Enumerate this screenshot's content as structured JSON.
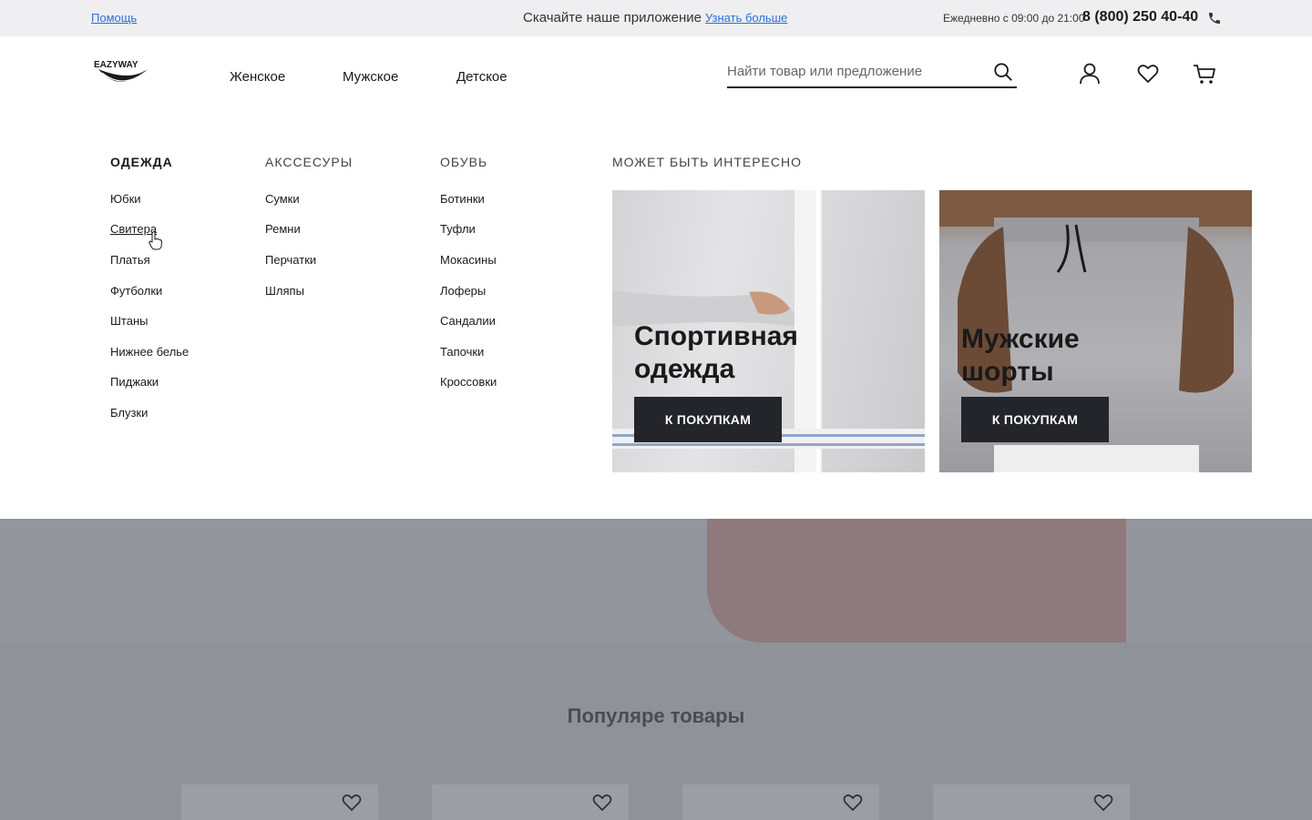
{
  "topbar": {
    "help": "Помощь",
    "promo": "Скачайте наше приложение",
    "promo_link": "Узнать больше",
    "hours": "Ежедневно с 09:00 до 21:00",
    "phone": "8 (800) 250 40-40"
  },
  "header": {
    "logo_text": "EAZYWAY",
    "nav": [
      "Женское",
      "Мужское",
      "Детское"
    ],
    "search_placeholder": "Найти товар или предложение"
  },
  "menu": {
    "columns": [
      {
        "title": "ОДЕЖДА",
        "items": [
          "Юбки",
          "Свитера",
          "Платья",
          "Футболки",
          "Штаны",
          "Нижнее белье",
          "Пиджаки",
          "Блузки"
        ]
      },
      {
        "title": "АКССЕСУРЫ",
        "items": [
          "Сумки",
          "Ремни",
          "Перчатки",
          "Шляпы"
        ]
      },
      {
        "title": "ОБУВЬ",
        "items": [
          "Ботинки",
          "Туфли",
          "Мокасины",
          "Лоферы",
          "Сандалии",
          "Тапочки",
          "Кроссовки"
        ]
      }
    ],
    "featured_title": "МОЖЕТ БЫТЬ ИНТЕРЕСНО",
    "cards": [
      {
        "title_line1": "Спортивная",
        "title_line2": "одежда",
        "button": "К ПОКУПКАМ"
      },
      {
        "title_line1": "Мужские",
        "title_line2": "шорты",
        "button": "К ПОКУПКАМ"
      }
    ]
  },
  "popular": {
    "title": "Популяре товары"
  },
  "colors": {
    "link": "#2a6fd6",
    "button_bg": "#23252b",
    "topbar_bg": "#efeff1"
  }
}
